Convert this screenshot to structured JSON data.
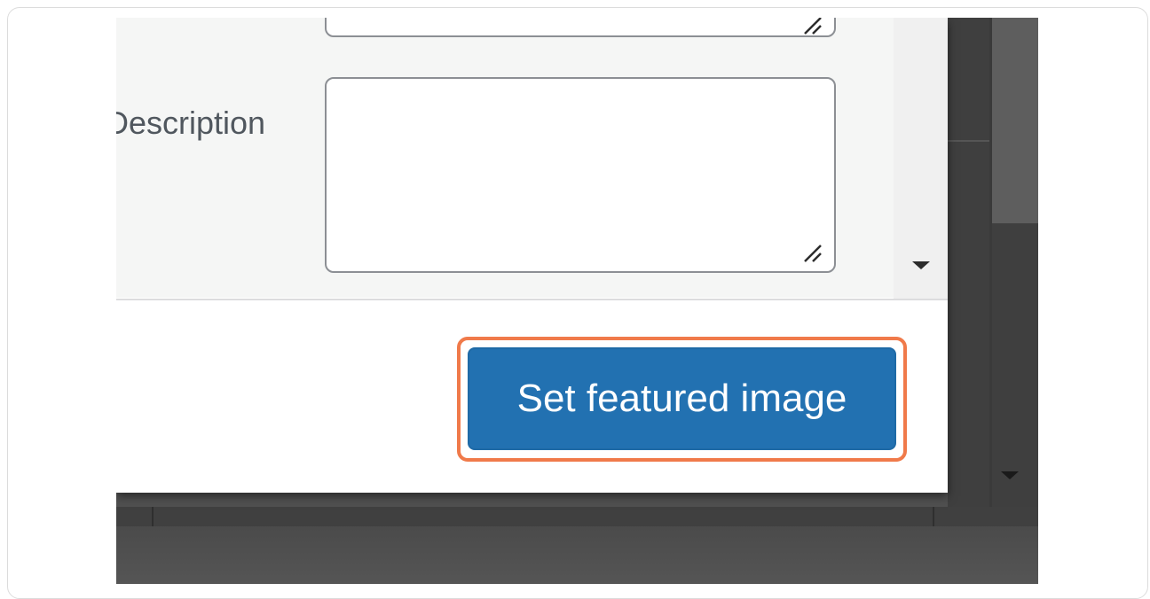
{
  "attachment_details": {
    "description_label": "Description",
    "description_value": "",
    "previous_field_value": ""
  },
  "footer": {
    "primary_button_label": "Set featured image"
  },
  "colors": {
    "primary_button": "#2271b1",
    "highlight_outline": "#f07a4a",
    "label_text": "#50575e",
    "field_border": "#8c8f94"
  },
  "icons": {
    "resize_grip": "resize-grip-icon",
    "scroll_down": "chevron-down-icon"
  }
}
